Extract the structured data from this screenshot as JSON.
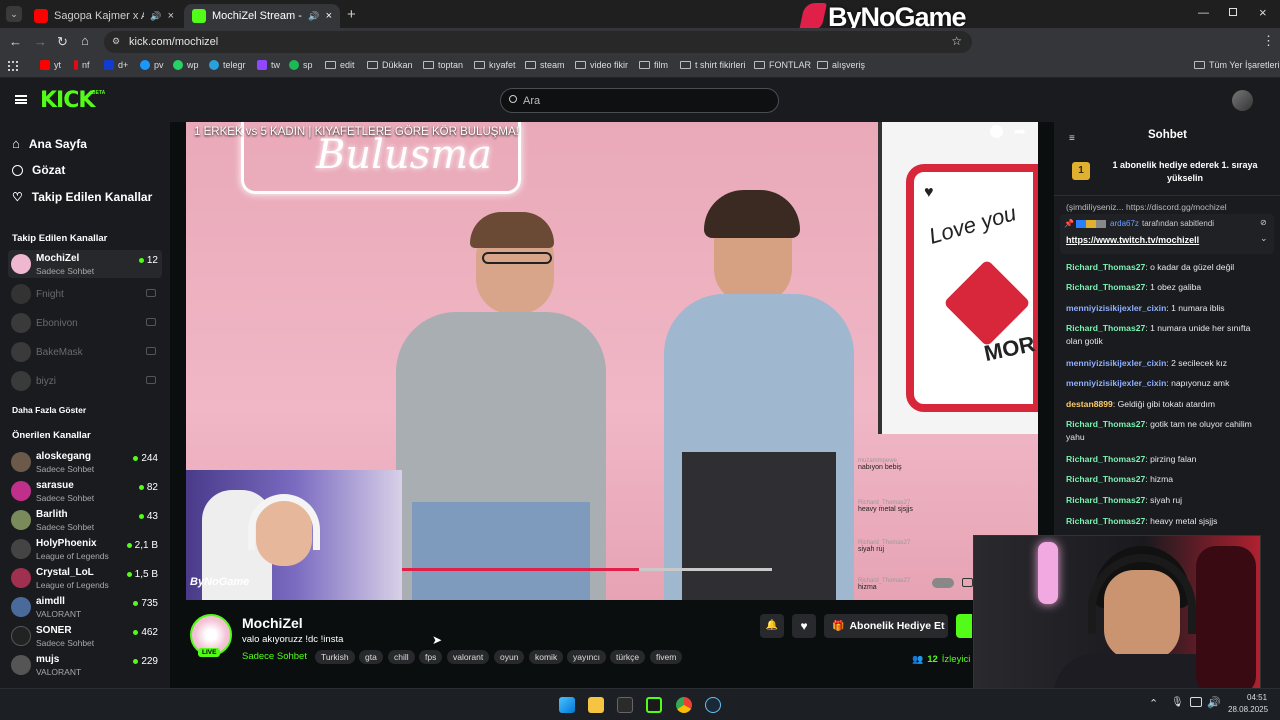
{
  "tabs": [
    {
      "title": "Sagopa Kajmer x Aleyna Til",
      "active": false
    },
    {
      "title": "MochiZel Stream - Watch Li",
      "active": true
    }
  ],
  "watermark": "ByNoGame",
  "url": "kick.com/mochizel",
  "bookmarks": [
    "yt",
    "nf",
    "d+",
    "pv",
    "wp",
    "telegr",
    "tw",
    "sp",
    "edit",
    "Dükkan",
    "toptan",
    "kıyafet",
    "steam",
    "video fikir",
    "film",
    "t shirt fikirleri",
    "FONTLAR",
    "alışveriş"
  ],
  "all_bookmarks": "Tüm Yer İşaretleri",
  "kick": {
    "logo": "KICK",
    "beta": "BETA",
    "search_placeholder": "Ara"
  },
  "sidebar": {
    "nav": [
      "Ana Sayfa",
      "Gözat",
      "Takip Edilen Kanallar"
    ],
    "followed_heading": "Takip Edilen Kanallar",
    "followed": [
      {
        "name": "MochiZel",
        "sub": "Sadece Sohbet",
        "viewers": "12"
      },
      {
        "name": "Fnight"
      },
      {
        "name": "Ebonivon"
      },
      {
        "name": "BakeMask"
      },
      {
        "name": "biyzi"
      }
    ],
    "show_more": "Daha Fazla Göster",
    "recommended_heading": "Önerilen Kanallar",
    "recommended": [
      {
        "name": "aloskegang",
        "sub": "Sadece Sohbet",
        "viewers": "244"
      },
      {
        "name": "sarasue",
        "sub": "Sadece Sohbet",
        "viewers": "82"
      },
      {
        "name": "Barlith",
        "sub": "Sadece Sohbet",
        "viewers": "43"
      },
      {
        "name": "HolyPhoenix",
        "sub": "League of Legends",
        "viewers": "2,1 B"
      },
      {
        "name": "Crystal_LoL",
        "sub": "League of Legends",
        "viewers": "1,5 B"
      },
      {
        "name": "aimdll",
        "sub": "VALORANT",
        "viewers": "735"
      },
      {
        "name": "SONER",
        "sub": "Sadece Sohbet",
        "viewers": "462"
      },
      {
        "name": "mujs",
        "sub": "VALORANT",
        "viewers": "229"
      }
    ]
  },
  "player": {
    "title": "1 ERKEK vs 5 KADIN | KIYAFETLERE GÖRE KÖR BULUŞMA!",
    "sign": "Bulusma",
    "poster_text": "Love you",
    "poster_more": "MOR",
    "brand": "ByNoGame",
    "progress": 0.64,
    "overlay_chat": [
      {
        "u": "muzammpewe",
        "m": "nabıyon bebiş"
      },
      {
        "u": "Richard_Thomas27",
        "m": "heavy metal sjsjjs"
      },
      {
        "u": "Richard_Thomas27",
        "m": "siyah ruj"
      },
      {
        "u": "Richard_Thomas27",
        "m": "hizma"
      }
    ]
  },
  "stream": {
    "name": "MochiZel",
    "title": "valo akıyoruzz !dc !insta",
    "category": "Sadece Sohbet",
    "tags": [
      "Turkish",
      "gta",
      "chill",
      "fps",
      "valorant",
      "oyun",
      "komik",
      "yayıncı",
      "türkçe",
      "fivem"
    ],
    "live": "LIVE",
    "gift_label": "Abonelik Hediye Et",
    "viewers": "12",
    "viewers_label": "İzleyici"
  },
  "chat": {
    "title": "Sohbet",
    "promo": "1 abonelik hediye ederek 1. sıraya yükselin",
    "promo_rank": "1",
    "cut_line": "(şimdiliyseniz... https://discord.gg/mochizel",
    "pinned_by": "arda67z",
    "pinned_label": "tarafından sabitlendi",
    "pinned_link": "https://www.twitch.tv/mochizell",
    "messages": [
      {
        "u": "Richard_Thomas27",
        "m": "o kadar da güzel değil",
        "c": "#7cf2b2"
      },
      {
        "u": "Richard_Thomas27",
        "m": "1 obez galiba",
        "c": "#7cf2b2"
      },
      {
        "u": "menniyizisikijexler_cixin",
        "m": "1 numara iblis",
        "c": "#8fb0ff"
      },
      {
        "u": "Richard_Thomas27",
        "m": "1 numara unide her sınıfta olan gotik",
        "c": "#7cf2b2"
      },
      {
        "u": "menniyizisikijexler_cixin",
        "m": "2 secilecek kız",
        "c": "#8fb0ff"
      },
      {
        "u": "menniyizisikijexler_cixin",
        "m": "napıyonuz amk",
        "c": "#8fb0ff"
      },
      {
        "u": "destan8899",
        "m": "Geldiği gibi tokatı atardım",
        "c": "#ffcc66"
      },
      {
        "u": "Richard_Thomas27",
        "m": "gotik tam ne oluyor cahilim yahu",
        "c": "#7cf2b2"
      },
      {
        "u": "Richard_Thomas27",
        "m": "pirzing falan",
        "c": "#7cf2b2"
      },
      {
        "u": "Richard_Thomas27",
        "m": "hizma",
        "c": "#7cf2b2"
      },
      {
        "u": "Richard_Thomas27",
        "m": "siyah ruj",
        "c": "#7cf2b2"
      },
      {
        "u": "Richard_Thomas27",
        "m": "heavy metal sjsjjs",
        "c": "#7cf2b2"
      }
    ]
  },
  "clock": {
    "time": "04:51",
    "date": "28.08.2025"
  },
  "colors": {
    "kick_green": "#53fc18",
    "accent_red": "#e1204a"
  }
}
